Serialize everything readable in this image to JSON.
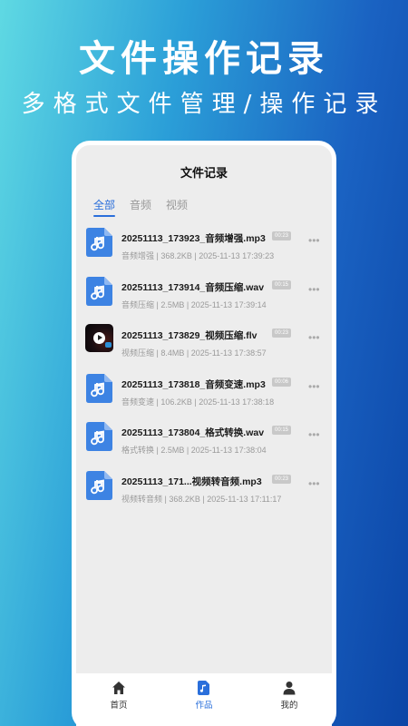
{
  "hero": {
    "title": "文件操作记录",
    "subtitle": "多格式文件管理/操作记录"
  },
  "screen": {
    "title": "文件记录",
    "tabs": [
      {
        "label": "全部",
        "active": true
      },
      {
        "label": "音频",
        "active": false
      },
      {
        "label": "视频",
        "active": false
      }
    ]
  },
  "files": [
    {
      "name": "20251113_173923_音频增强.mp3",
      "duration": "00:23",
      "meta": "音频增强 | 368.2KB | 2025-11-13 17:39:23",
      "icon": "music-file-icon"
    },
    {
      "name": "20251113_173914_音频压缩.wav",
      "duration": "00:15",
      "meta": "音频压缩 | 2.5MB | 2025-11-13 17:39:14",
      "icon": "music-file-icon"
    },
    {
      "name": "20251113_173829_视频压缩.flv",
      "duration": "00:23",
      "meta": "视频压缩 | 8.4MB | 2025-11-13 17:38:57",
      "icon": "video-thumbnail"
    },
    {
      "name": "20251113_173818_音频变速.mp3",
      "duration": "00:06",
      "meta": "音频变速 | 106.2KB | 2025-11-13 17:38:18",
      "icon": "music-file-icon"
    },
    {
      "name": "20251113_173804_格式转换.wav",
      "duration": "00:15",
      "meta": "格式转换 | 2.5MB | 2025-11-13 17:38:04",
      "icon": "music-file-icon"
    },
    {
      "name": "20251113_171...视频转音频.mp3",
      "duration": "00:23",
      "meta": "视频转音频 | 368.2KB | 2025-11-13 17:11:17",
      "icon": "music-file-icon"
    }
  ],
  "more_icon": "more-horizontal-icon",
  "nav": [
    {
      "label": "首页",
      "icon": "home-icon",
      "active": false
    },
    {
      "label": "作品",
      "icon": "music-file-icon",
      "active": true
    },
    {
      "label": "我的",
      "icon": "user-icon",
      "active": false
    }
  ],
  "colors": {
    "accent": "#2a6fdb",
    "file_icon": "#3d83e3"
  }
}
